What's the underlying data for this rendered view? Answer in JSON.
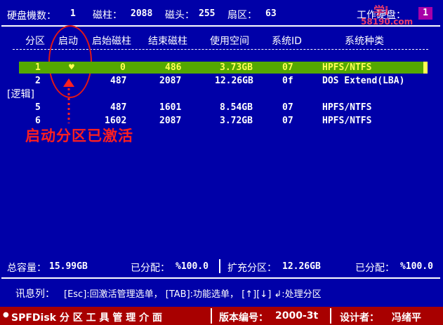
{
  "top_bar": {
    "disk_count_label": "硬盘機数：",
    "disk_count": "1",
    "cylinders_label": "磁柱：",
    "cylinders": "2088",
    "heads_label": "磁头：",
    "heads": "255",
    "sectors_label": "扇区：",
    "sectors": "63",
    "current_disk_label": "工作硬盘：",
    "current_disk": "1",
    "watermark_top": "学i",
    "watermark_bottom": "58190.com"
  },
  "table": {
    "headers": [
      "分区",
      "启动",
      "启始磁柱",
      "结束磁柱",
      "使用空间",
      "系统ID",
      "系统种类"
    ],
    "rows": [
      {
        "part": "1",
        "boot": "♥",
        "start": "0",
        "end": "486",
        "size": "3.73GB",
        "id": "07",
        "type": "HPFS/NTFS"
      },
      {
        "part": "2",
        "boot": "",
        "start": "487",
        "end": "2087",
        "size": "12.26GB",
        "id": "0f",
        "type": "DOS Extend(LBA)"
      },
      {
        "logical_label": "[逻辑]"
      },
      {
        "part": "5",
        "boot": "",
        "start": "487",
        "end": "1601",
        "size": "8.54GB",
        "id": "07",
        "type": "HPFS/NTFS"
      },
      {
        "part": "6",
        "boot": "",
        "start": "1602",
        "end": "2087",
        "size": "3.72GB",
        "id": "07",
        "type": "HPFS/NTFS"
      }
    ]
  },
  "annotation": {
    "text": "启动分区已激活"
  },
  "summary": {
    "total_label": "总容量：",
    "total": "15.99GB",
    "allocated_label": "已分配：",
    "allocated": "%100.0",
    "extended_label": "扩充分区：",
    "extended": "12.26GB",
    "allocated2_label": "已分配：",
    "allocated2": "%100.0"
  },
  "message": {
    "label": "讯息列：",
    "text": "[Esc]:回激活管理选单， [TAB]:功能选单， [↑][↓] ↲:处理分区"
  },
  "status_bar": {
    "app_name": "SPFDisk 分 区 工 具 管 理 介 面",
    "version_label": "版本编号：",
    "version": "2000-3t",
    "designer_label": "设计者：",
    "designer": "冯绪平"
  },
  "colors": {
    "background": "#0000a8",
    "selection": "#54a800",
    "status_bar": "#a80000",
    "annotation": "#ff1f1f",
    "selected_text": "#ffff54"
  }
}
